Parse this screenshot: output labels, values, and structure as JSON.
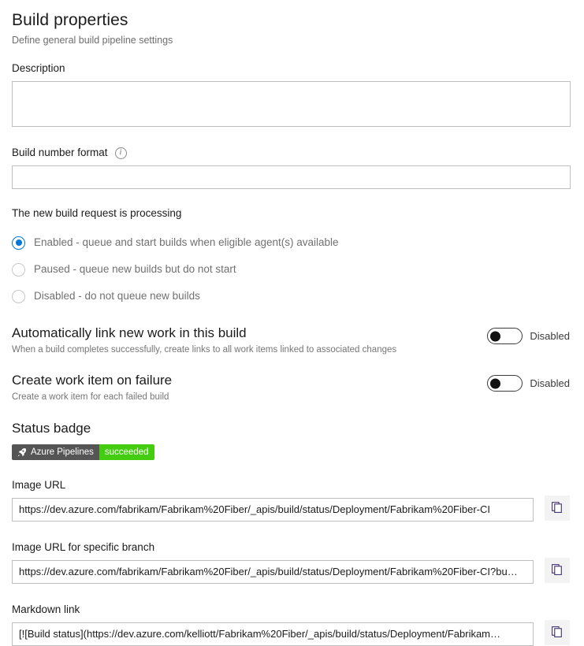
{
  "header": {
    "title": "Build properties",
    "subtitle": "Define general build pipeline settings"
  },
  "description": {
    "label": "Description",
    "value": "",
    "placeholder": ""
  },
  "build_number_format": {
    "label": "Build number format",
    "info_icon": "info-icon",
    "value": "",
    "placeholder": ""
  },
  "processing": {
    "label": "The new build request is processing",
    "selected": "Enabled",
    "options": [
      {
        "id": "enabled",
        "label": "Enabled - queue and start builds when eligible agent(s) available",
        "checked": true
      },
      {
        "id": "paused",
        "label": "Paused - queue new builds but do not start",
        "checked": false
      },
      {
        "id": "disabled",
        "label": "Disabled - do not queue new builds",
        "checked": false
      }
    ]
  },
  "auto_link": {
    "heading": "Automatically link new work in this build",
    "description": "When a build completes successfully, create links to all work items linked to associated changes",
    "toggle_state": "Disabled",
    "toggle_on": false
  },
  "create_work_item": {
    "heading": "Create work item on failure",
    "description": "Create a work item for each failed build",
    "toggle_state": "Disabled",
    "toggle_on": false
  },
  "status_badge": {
    "heading": "Status badge",
    "badge_left_text": "Azure Pipelines",
    "badge_right_text": "succeeded",
    "badge_left_color": "#555555",
    "badge_right_color": "#44cc11",
    "rocket_icon": "rocket-icon"
  },
  "image_url": {
    "label": "Image URL",
    "value": "https://dev.azure.com/fabrikam/Fabrikam%20Fiber/_apis/build/status/Deployment/Fabrikam%20Fiber-CI",
    "copy_icon": "copy-icon"
  },
  "image_url_branch": {
    "label": "Image URL for specific branch",
    "value": "https://dev.azure.com/fabrikam/Fabrikam%20Fiber/_apis/build/status/Deployment/Fabrikam%20Fiber-CI?bu…",
    "copy_icon": "copy-icon"
  },
  "markdown_link": {
    "label": "Markdown link",
    "value": "[![Build status](https://dev.azure.com/kelliott/Fabrikam%20Fiber/_apis/build/status/Deployment/Fabrikam…",
    "copy_icon": "copy-icon"
  },
  "colors": {
    "accent": "#0078d4",
    "badge_success": "#44cc11",
    "badge_dark": "#555555",
    "text_primary": "#1b1b1b",
    "text_muted": "#6e6e6e",
    "border": "#bfbfbf"
  }
}
